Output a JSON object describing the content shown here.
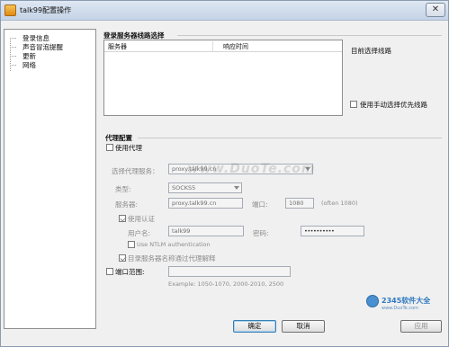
{
  "window": {
    "title": "talk99配置操作",
    "close_label": "✕"
  },
  "nav": {
    "items": [
      {
        "label": "登录信息"
      },
      {
        "label": "声音冒泡提醒"
      },
      {
        "label": "更新"
      },
      {
        "label": "网络"
      }
    ]
  },
  "server_section": {
    "title": "登录服务器线路选择",
    "columns": [
      "服务器",
      "响应时间"
    ],
    "current_route_label": "目前选择线路",
    "manual_select_label": "使用手动选择优先线路",
    "manual_select_checked": false
  },
  "proxy_section": {
    "title": "代理配置",
    "use_proxy_label": "使用代理",
    "use_proxy_checked": false,
    "select_server_label": "选择代理服务：",
    "select_server_value": "proxy.talk99.cn",
    "type_label": "类型:",
    "type_value": "SOCKS5",
    "server_label": "服务器:",
    "server_value": "proxy.talk99.cn",
    "port_label": "端口:",
    "port_value": "1080",
    "port_hint": "(often 1080)",
    "use_auth_label": "使用认证",
    "use_auth_checked": true,
    "username_label": "用户名:",
    "username_value": "talk99",
    "password_label": "密码:",
    "password_value": "••••••••••",
    "ntlm_label": "Use NTLM authentication",
    "ntlm_checked": false,
    "resolve_via_proxy_label": "目录服务器名称通过代理解释",
    "resolve_via_proxy_checked": true,
    "port_range_label": "端口范围:",
    "port_range_checked": false,
    "port_range_value": "",
    "port_range_example": "Example: 1050-1070, 2000-2010, 2500"
  },
  "buttons": {
    "ok": "确定",
    "cancel": "取消",
    "apply": "应用"
  },
  "watermark": "www.DuoTe.com",
  "logo": {
    "brand": "2345软件大全",
    "sub": "www.DuoTe.com"
  },
  "colors": {
    "titlebar": "#c3d3e6",
    "ok_border": "#3c7fb1",
    "disabled_text": "#8c8c8c"
  }
}
